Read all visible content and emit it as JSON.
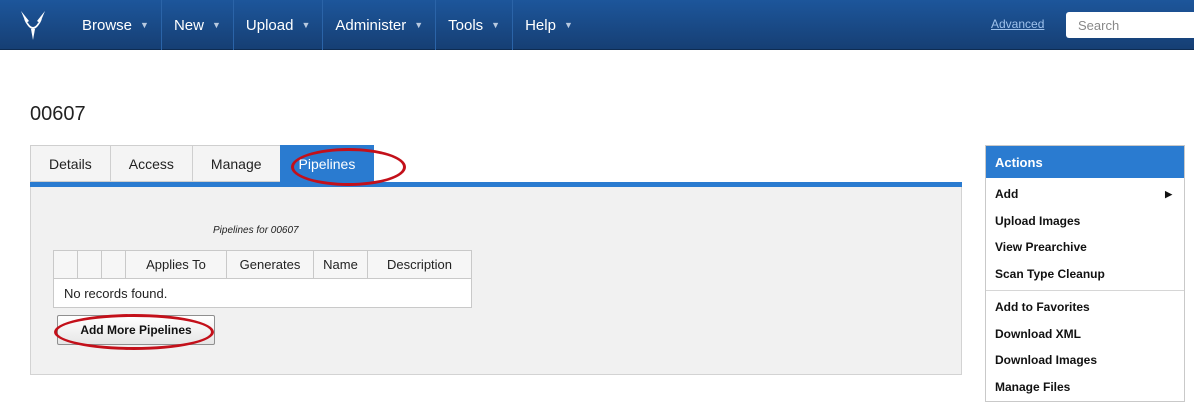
{
  "nav": {
    "menu": [
      {
        "label": "Browse"
      },
      {
        "label": "New"
      },
      {
        "label": "Upload"
      },
      {
        "label": "Administer"
      },
      {
        "label": "Tools"
      },
      {
        "label": "Help"
      }
    ],
    "advanced_label": "Advanced",
    "search_placeholder": "Search"
  },
  "page": {
    "title": "00607"
  },
  "tabs": [
    {
      "label": "Details"
    },
    {
      "label": "Access"
    },
    {
      "label": "Manage"
    },
    {
      "label": "Pipelines",
      "active": true
    }
  ],
  "pipelines": {
    "caption": "Pipelines for 00607",
    "columns": [
      "",
      "",
      "",
      "Applies To",
      "Generates",
      "Name",
      "Description"
    ],
    "empty_text": "No records found.",
    "add_button": "Add More Pipelines"
  },
  "actions": {
    "title": "Actions",
    "group1": [
      "Add",
      "Upload Images",
      "View Prearchive",
      "Scan Type Cleanup"
    ],
    "group2": [
      "Add to Favorites",
      "Download XML",
      "Download Images",
      "Manage Files"
    ]
  },
  "colors": {
    "nav_bg": "#1a4e8e",
    "accent": "#2a7bd0",
    "annotation": "#c3101a"
  }
}
